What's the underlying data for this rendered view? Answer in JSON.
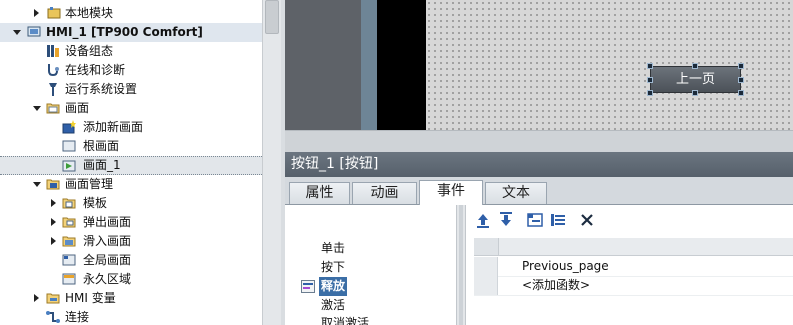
{
  "project_tree": {
    "items": [
      {
        "label": "本地模块",
        "icon": "local-module-icon",
        "expander": "right",
        "indent": 2,
        "bold": false
      },
      {
        "label": "HMI_1 [TP900 Comfort]",
        "icon": "hmi-device-icon",
        "expander": "down",
        "indent": 0,
        "bold": true
      },
      {
        "label": "设备组态",
        "icon": "device-config-icon",
        "expander": "",
        "indent": 1,
        "bold": false
      },
      {
        "label": "在线和诊断",
        "icon": "online-diagnostics-icon",
        "expander": "",
        "indent": 1,
        "bold": false
      },
      {
        "label": "运行系统设置",
        "icon": "runtime-settings-icon",
        "expander": "",
        "indent": 1,
        "bold": false
      },
      {
        "label": "画面",
        "icon": "folder-icon",
        "expander": "down",
        "indent": 1,
        "bold": false
      },
      {
        "label": "添加新画面",
        "icon": "add-screen-icon",
        "expander": "",
        "indent": 2,
        "bold": false
      },
      {
        "label": "根画面",
        "icon": "screen-icon",
        "expander": "",
        "indent": 2,
        "bold": false
      },
      {
        "label": "画面_1",
        "icon": "screen-open-icon",
        "expander": "",
        "indent": 2,
        "bold": false,
        "selected": true
      },
      {
        "label": "画面管理",
        "icon": "screen-management-folder-icon",
        "expander": "down",
        "indent": 1,
        "bold": false
      },
      {
        "label": "模板",
        "icon": "template-folder-icon",
        "expander": "right",
        "indent": 2,
        "bold": false
      },
      {
        "label": "弹出画面",
        "icon": "popup-folder-icon",
        "expander": "right",
        "indent": 2,
        "bold": false
      },
      {
        "label": "滑入画面",
        "icon": "slidein-folder-icon",
        "expander": "right",
        "indent": 2,
        "bold": false
      },
      {
        "label": "全局画面",
        "icon": "global-screen-icon",
        "expander": "",
        "indent": 2,
        "bold": false
      },
      {
        "label": "永久区域",
        "icon": "permanent-area-icon",
        "expander": "",
        "indent": 2,
        "bold": false
      },
      {
        "label": "HMI 变量",
        "icon": "hmi-tags-folder-icon",
        "expander": "right",
        "indent": 1,
        "bold": false
      },
      {
        "label": "连接",
        "icon": "connections-icon",
        "expander": "",
        "indent": 1,
        "bold": false
      }
    ]
  },
  "editor": {
    "screen_button_label": "上一页"
  },
  "inspector": {
    "title": "按钮_1 [按钮]",
    "tabs": [
      "属性",
      "动画",
      "事件",
      "文本"
    ],
    "active_tab_index": 2,
    "events": [
      "单击",
      "按下",
      "释放",
      "激活",
      "取消激活"
    ],
    "selected_event_index": 2,
    "toolbar_icons": [
      "move-up-icon",
      "move-down-icon",
      "insert-function-icon",
      "function-list-icon",
      "delete-icon"
    ],
    "function_rows": [
      "Previous_page",
      "<添加函数>"
    ]
  },
  "colors": {
    "inspector_title_bg": "#5f6974",
    "selection_blue": "#3b6ea6",
    "canvas_bg": "#d7d7d7",
    "screen_button_bg": "#5b6168"
  }
}
